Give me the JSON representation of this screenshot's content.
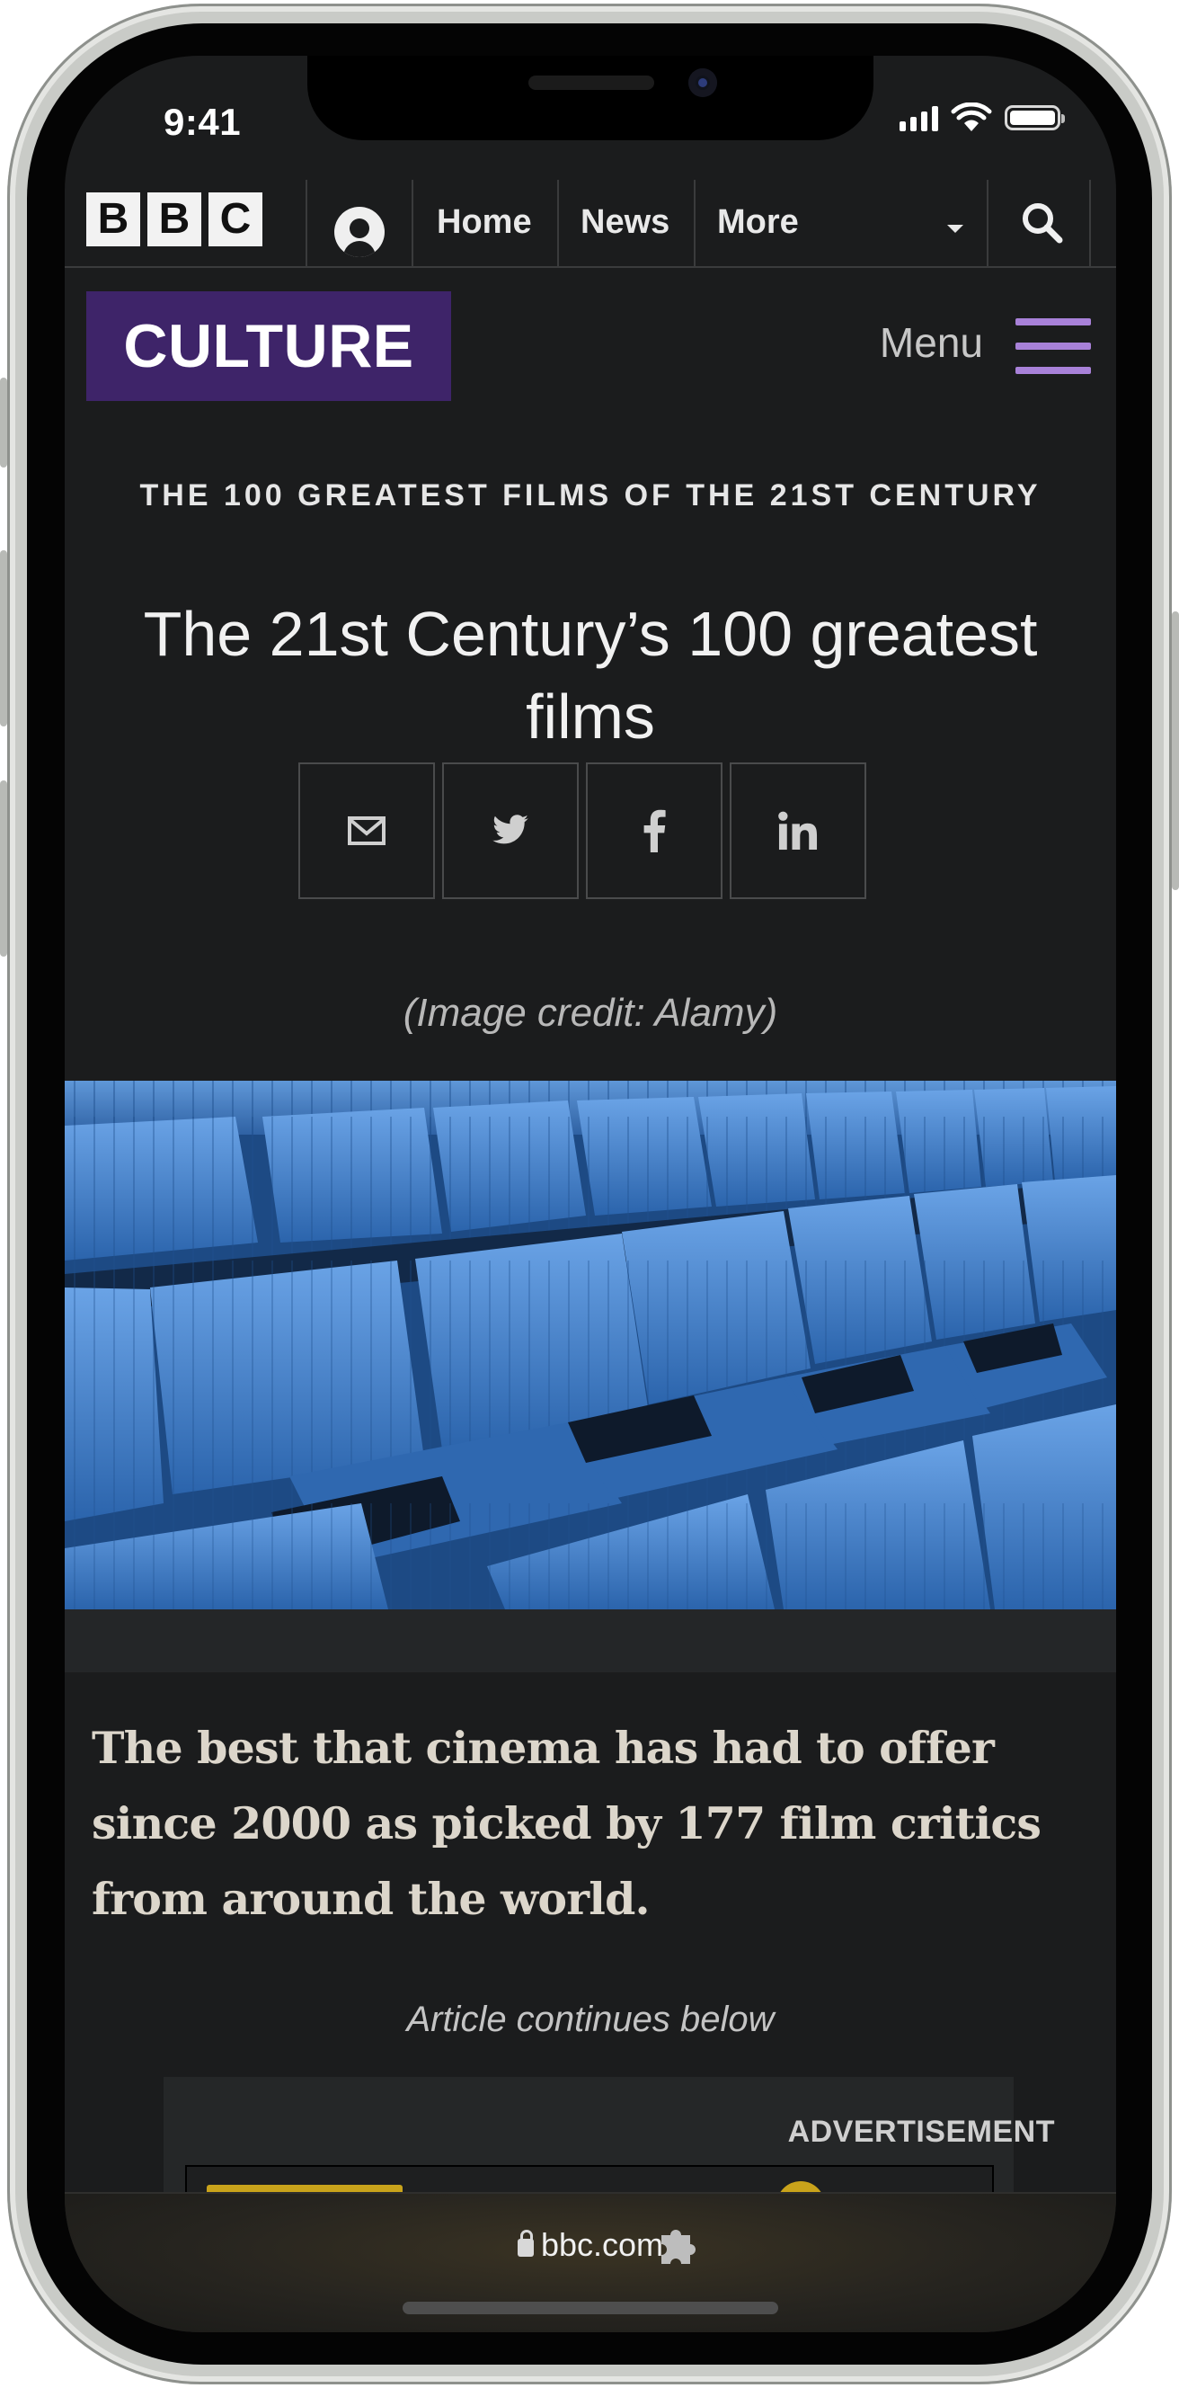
{
  "status_bar": {
    "time": "9:41"
  },
  "bbc_nav": {
    "logo_letters": [
      "B",
      "B",
      "C"
    ],
    "links": [
      "Home",
      "News",
      "More"
    ]
  },
  "culture_header": {
    "brand": "CULTURE",
    "menu_label": "Menu",
    "accent_color": "#a881d8",
    "brand_color": "#3e2469"
  },
  "article": {
    "kicker": "THE 100 GREATEST FILMS OF THE 21ST CENTURY",
    "headline": "The 21st Century’s 100 greatest films",
    "share_buttons": [
      "email-icon",
      "twitter-icon",
      "facebook-icon",
      "linkedin-icon"
    ],
    "image_credit": "(Image credit: Alamy)",
    "summary": "The best that cinema has had to offer since 2000 as picked by 177 film critics from around the world.",
    "continues": "Article continues below"
  },
  "advertisement": {
    "label": "ADVERTISEMENT"
  },
  "browser": {
    "url": "bbc.com"
  }
}
